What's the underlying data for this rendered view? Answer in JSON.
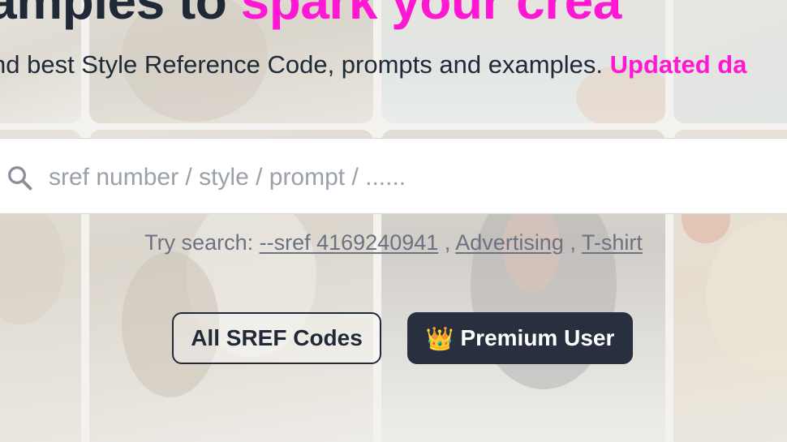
{
  "hero": {
    "title_part1": "xamples to ",
    "title_part2": "spark your crea",
    "subtitle": "nd best Style Reference Code, prompts and examples. ",
    "subtitle_accent": "Updated da",
    "accent_color": "#ff18d4"
  },
  "search": {
    "placeholder": "sref number / style / prompt / ......",
    "value": "",
    "icon": "search-icon"
  },
  "try_search": {
    "label": "Try search: ",
    "suggestions": [
      "--sref 4169240941",
      "Advertising",
      "T-shirt"
    ],
    "separator": " , "
  },
  "buttons": {
    "all_codes": "All SREF Codes",
    "premium_icon": "👑",
    "premium": "Premium User"
  },
  "colors": {
    "text_dark": "#1f2937",
    "muted": "#6b7280",
    "button_dark": "#283040"
  }
}
